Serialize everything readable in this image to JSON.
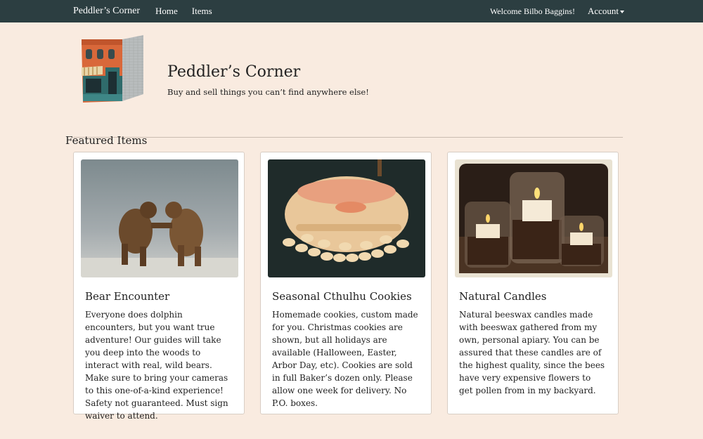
{
  "nav": {
    "brand": "Peddler’s Corner",
    "links": [
      "Home",
      "Items"
    ],
    "welcome": "Welcome Bilbo Baggins!",
    "account": "Account"
  },
  "hero": {
    "title": "Peddler’s Corner",
    "subtitle": "Buy and sell things you can’t find anywhere else!"
  },
  "featured": {
    "heading": "Featured Items",
    "items": [
      {
        "title": "Bear Encounter",
        "description": "Everyone does dolphin encounters, but you want true adventure! Our guides will take you deep into the woods to interact with real, wild bears. Make sure to bring your cameras to this one-of-a-kind experience! Safety not guaranteed. Must sign waiver to attend."
      },
      {
        "title": "Seasonal Cthulhu Cookies",
        "description": "Homemade cookies, custom made for you. Christmas cookies are shown, but all holidays are available (Halloween, Easter, Arbor Day, etc). Cookies are sold in full Baker’s dozen only. Please allow one week for delivery. No P.O. boxes."
      },
      {
        "title": "Natural Candles",
        "description": "Natural beeswax candles made with beeswax gathered from my own, personal apiary. You can be assured that these candles are of the highest quality, since the bees have very expensive flowers to get pollen from in my backyard."
      }
    ]
  }
}
